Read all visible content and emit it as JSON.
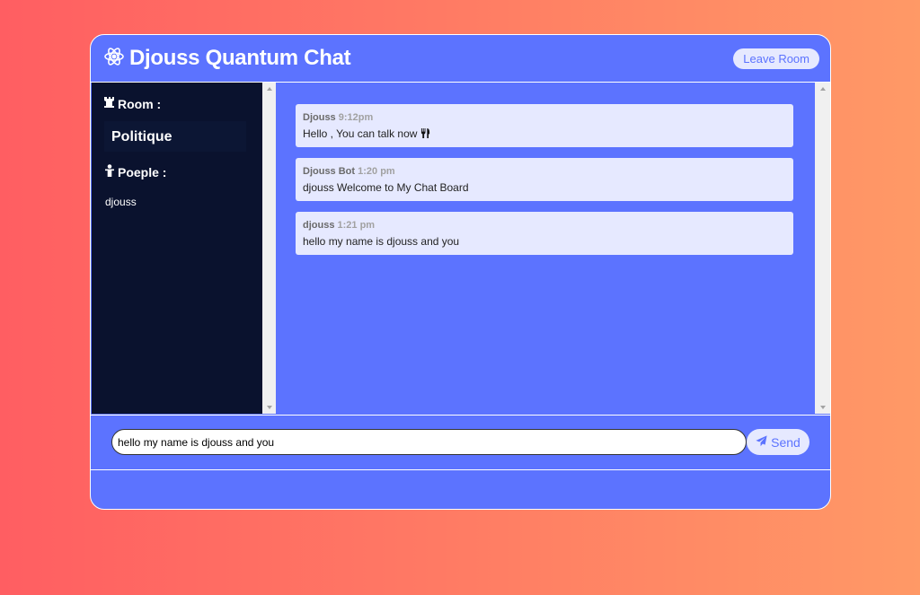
{
  "app": {
    "title": "Djouss Quantum Chat",
    "leave_label": "Leave Room"
  },
  "sidebar": {
    "room_heading": "Room :",
    "room_name": "Politique",
    "people_heading": "Poeple :",
    "users": [
      "djouss"
    ]
  },
  "messages": [
    {
      "author": "Djouss",
      "time": "9:12pm",
      "text": "Hello , You can talk now"
    },
    {
      "author": "Djouss Bot",
      "time": "1:20 pm",
      "text": "djouss Welcome to My Chat Board"
    },
    {
      "author": "djouss",
      "time": "1:21 pm",
      "text": "hello my name is djouss and you"
    }
  ],
  "composer": {
    "input_value": "hello my name is djouss and you",
    "send_label": "Send"
  },
  "icons": {
    "brand": "atom-icon",
    "room": "chess-rook-icon",
    "people": "user-icon",
    "emoji": "utensils-icon",
    "send": "paper-plane-icon"
  },
  "colors": {
    "accent": "#5c73ff",
    "sidebar": "#0a122e",
    "bubble": "#e6e9ff"
  }
}
